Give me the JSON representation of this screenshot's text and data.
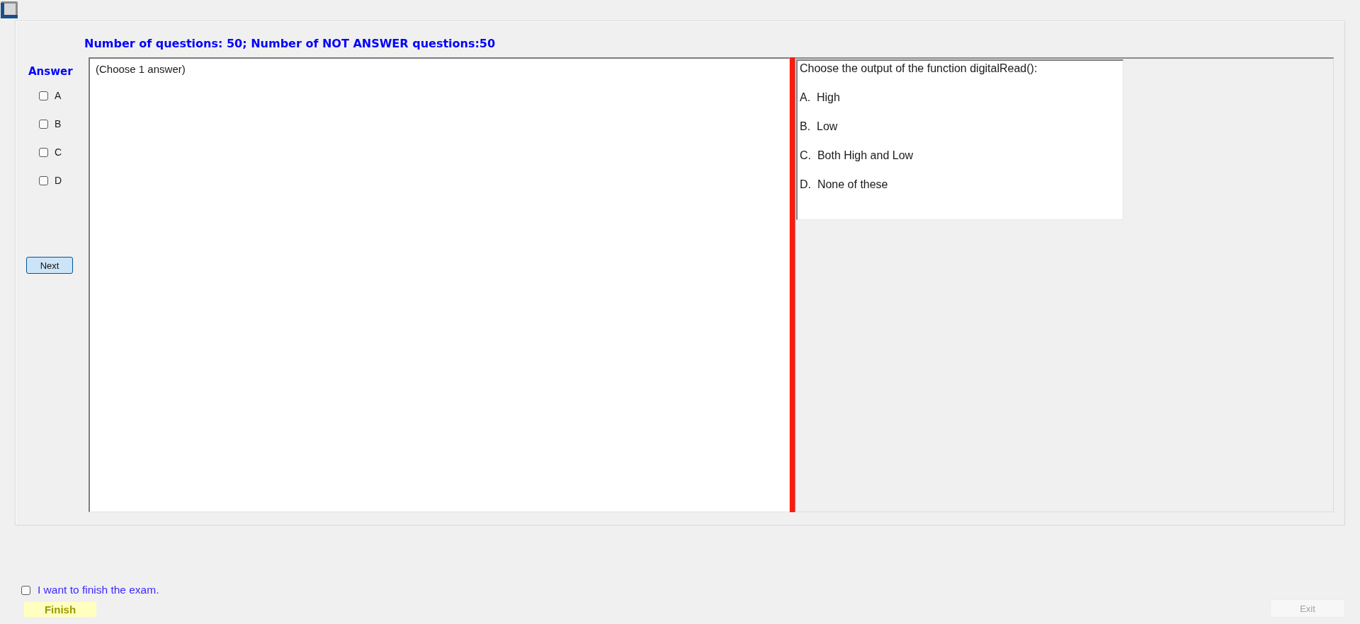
{
  "header": {
    "summary": "Number of questions: 50; Number of NOT ANSWER questions:50"
  },
  "answer_panel": {
    "title": "Answer",
    "options": [
      {
        "label": "A",
        "checked": false
      },
      {
        "label": "B",
        "checked": false
      },
      {
        "label": "C",
        "checked": false
      },
      {
        "label": "D",
        "checked": false
      }
    ],
    "next_button": "Next"
  },
  "instructions": {
    "text": "(Choose 1 answer)"
  },
  "question": {
    "prompt": "Choose the output of the function digitalRead():",
    "choices": [
      "A.  High",
      "B.  Low",
      "C.  Both High and Low",
      "D.  None of these"
    ]
  },
  "footer": {
    "confirm": {
      "label": "I want to finish the exam.",
      "checked": false
    },
    "finish_button": "Finish",
    "exit_button": {
      "label": "Exit",
      "disabled": true
    }
  }
}
